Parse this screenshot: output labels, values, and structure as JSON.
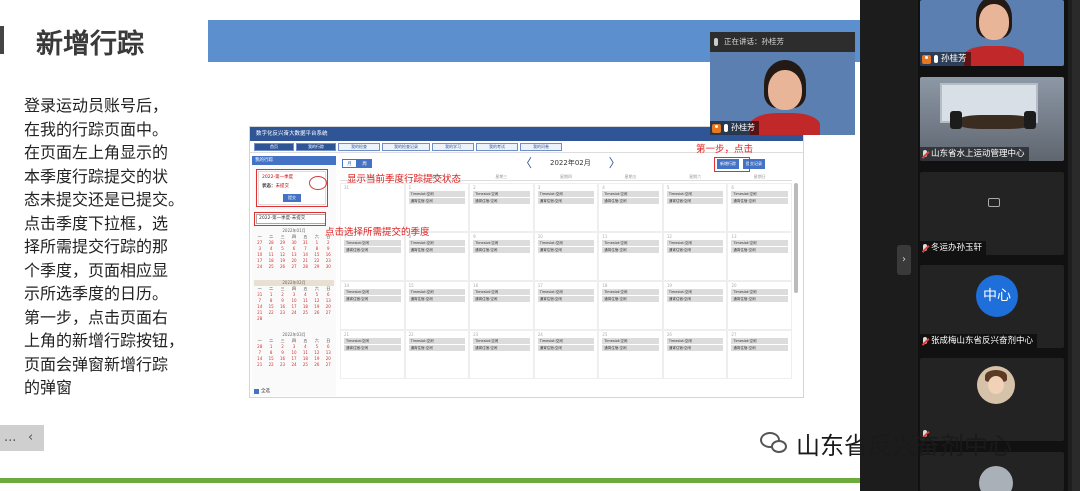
{
  "slide": {
    "title": "新增行踪",
    "body_lines": [
      "登录运动员账号后，",
      "在我的行踪页面中。",
      "在页面左上角显示的",
      "本季度行踪提交的状",
      "态未提交还是已提交。",
      "点击季度下拉框，选",
      "择所需提交行踪的那",
      "个季度，页面相应显",
      "示所选季度的日历。",
      "第一步，点击页面右",
      "上角的新增行踪按钮，",
      "页面会弹窗新增行踪",
      "的弹窗"
    ],
    "side_nav_label": "...",
    "side_nav_arrow": "‹"
  },
  "app": {
    "header_title": "数字化反兴奋大数据平台系统",
    "nav_tabs": [
      "首页",
      "我的行踪",
      "我的检查",
      "我的检查记录",
      "我的学习",
      "我的考试",
      "我的问卷"
    ],
    "panel_title": "我的行踪",
    "season_card": {
      "title": "2022-第一季度",
      "status_label": "状态：",
      "status_value": "未提交",
      "button": "提交"
    },
    "season_select": "2022-第一季度-未提交",
    "mini_calendars": [
      {
        "month": "2022年01月",
        "days": [
          "27",
          "28",
          "29",
          "30",
          "31",
          "1",
          "2",
          "3",
          "4",
          "5",
          "6",
          "7",
          "8",
          "9",
          "10",
          "11",
          "12",
          "13",
          "14",
          "15",
          "16",
          "17",
          "18",
          "19",
          "20",
          "21",
          "22",
          "23",
          "24",
          "25",
          "26",
          "27",
          "28",
          "29",
          "30"
        ]
      },
      {
        "month": "2022年02月",
        "days": [
          "31",
          "1",
          "2",
          "3",
          "4",
          "5",
          "6",
          "7",
          "8",
          "9",
          "10",
          "11",
          "12",
          "13",
          "14",
          "15",
          "16",
          "17",
          "18",
          "19",
          "20",
          "21",
          "22",
          "23",
          "24",
          "25",
          "26",
          "27",
          "28"
        ]
      },
      {
        "month": "2022年03月",
        "days": [
          "28",
          "1",
          "2",
          "3",
          "4",
          "5",
          "6",
          "7",
          "8",
          "9",
          "10",
          "11",
          "12",
          "13",
          "14",
          "15",
          "16",
          "17",
          "18",
          "19",
          "20",
          "21",
          "22",
          "23",
          "24",
          "25",
          "26",
          "27"
        ]
      }
    ],
    "weekday_labels": [
      "一",
      "二",
      "三",
      "四",
      "五",
      "六",
      "日"
    ],
    "legend_label": "全选",
    "view_tabs": [
      "月",
      "周"
    ],
    "month_label": "2022年02月",
    "prev_arrow": "〈",
    "next_arrow": "〉",
    "top_buttons": [
      "新增行踪",
      "提交记录"
    ],
    "week_header": [
      "星期一",
      "星期二",
      "星期三",
      "星期四",
      "星期五",
      "星期六",
      "星期日"
    ],
    "calendar_days": [
      "31",
      "1",
      "2",
      "3",
      "4",
      "5",
      "6",
      "7",
      "8",
      "9",
      "10",
      "11",
      "12",
      "13",
      "14",
      "15",
      "16",
      "17",
      "18",
      "19",
      "20",
      "21",
      "22",
      "23",
      "24",
      "25",
      "26",
      "27"
    ],
    "event_labels": [
      "Timeslot:空闲",
      "通宵住宿:空闲"
    ]
  },
  "annotations": {
    "step1": "第一步，点击",
    "status_hint": "显示当前季度行踪提交状态",
    "select_hint": "点击选择所需提交的季度"
  },
  "meeting": {
    "speaking_label": "正在讲话：孙桂芳",
    "speaker_name": "孙桂芳",
    "participants": [
      {
        "name": "孙桂芳",
        "kind": "video-person"
      },
      {
        "name": "山东省水上运动管理中心",
        "kind": "video-room"
      },
      {
        "name": "冬运办孙玉轩",
        "kind": "camera-off"
      },
      {
        "name": "张成梅山东省反兴奋剂中心",
        "kind": "avatar",
        "avatar_text": "中心"
      },
      {
        "name": "",
        "kind": "photo-avatar"
      }
    ],
    "collapse_icon": "›"
  },
  "watermark": {
    "text": "山东省反兴奋剂中心"
  },
  "colors": {
    "title_band": "#5b8fce",
    "app_header": "#2f5597",
    "annotation": "#e02020",
    "accent_blue": "#4472c4",
    "bottom_line": "#6cab3c",
    "avatar_blue": "#1e6fd9"
  }
}
